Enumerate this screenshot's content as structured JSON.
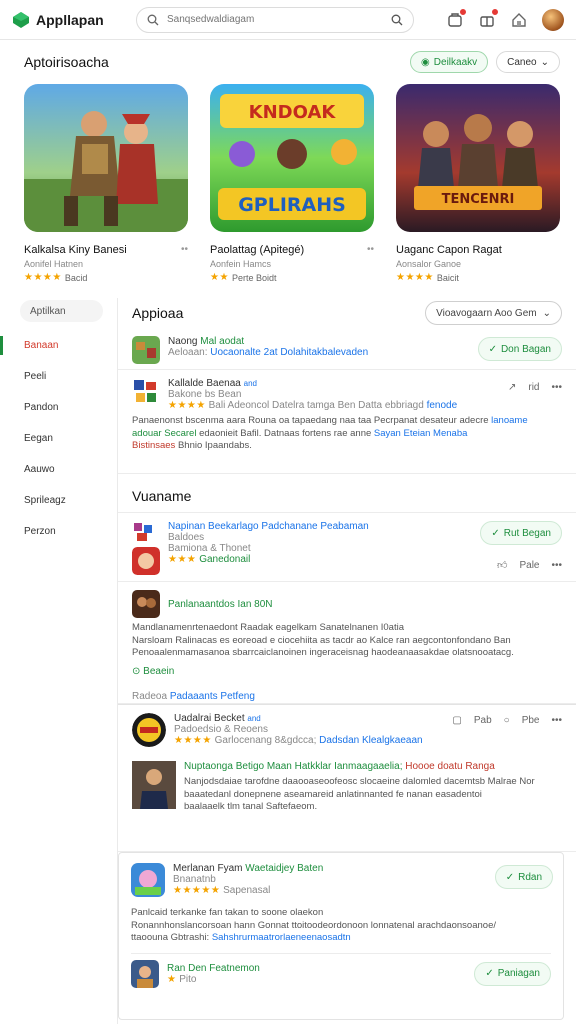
{
  "header": {
    "app_name": "Appllapan",
    "search_placeholder": "Sanqsedwaldiagam",
    "icons": [
      "logo-diamond-icon",
      "search-icon",
      "notification-icon",
      "gift-icon",
      "home-icon"
    ],
    "accent": "#1e8e3e"
  },
  "featured": {
    "title": "Aptoirisoacha",
    "green_button": "Deilkaakv",
    "select_button": "Caneo",
    "cards": [
      {
        "name": "Kalkalsa Kiny Banesi",
        "sub": "Aonifel Hatnen",
        "stars": "★★★★",
        "rating_text": "Bacid"
      },
      {
        "name": "Paolattag (Apitegé)",
        "sub": "Aonfein Hamcs",
        "stars": "★★",
        "rating_text": "Perte Boidt"
      },
      {
        "name": "Uaganc Capon Ragat",
        "sub": "Aonsalor Ganoe",
        "stars": "★★★★",
        "rating_text": "Baicit"
      }
    ]
  },
  "nav": {
    "items": [
      "Aptilkan",
      "Banaan",
      "Peeli",
      "Pandon",
      "Eegan",
      "Aauwo",
      "Sprileagz",
      "Perzon"
    ]
  },
  "feed": {
    "heading": "Appioaa",
    "sort_label": "Vioavogaarn Aoo Gem",
    "item1": {
      "title": "Naong",
      "title_green": "Mal aodat",
      "meta": "Aeloaan:",
      "meta_link": "Uocaonalte 2at Dolahitakbalevaden",
      "button": "Don Bagan"
    },
    "item2": {
      "title": "Kallalde Baenaa",
      "tag": "and",
      "sub": "Bakone bs Bean",
      "stars": "★★★★",
      "rating_line": "Bali Adeoncol Datelra tamga Ben Datta ebbriagd",
      "rating_link": "fenode",
      "para1": "Panaenonst bscenma aara Rouna oa tapaedang naa taa Pecrpanat desateur adecre",
      "para1_link": "lanoame",
      "para2": "adouar",
      "para2_green": "Secarel",
      "para2_rest": "edaonieit Bafil. Datnaas fortens rae anne",
      "para2_link": "Sayan Eteian Menaba",
      "para3_red": "Bistinsaes",
      "para3": "Bhnio Ipaandabs.",
      "act_share": "rid"
    },
    "section2": "Vuaname",
    "item3": {
      "title": "Napinan Beekarlago",
      "title_link": "Padchanane Peabaman",
      "sub": "Baldoes",
      "name2": "Bamiona & Thonet",
      "stars": "★★★",
      "green_link": "Ganedonail",
      "button": "Rut Began",
      "act_like": "Pale"
    },
    "item4": {
      "title_green": "Panlanaantdos Ian 80N",
      "para1": "Mandlanamenrtenaedont Raadak eagelkam Sanatelnanen I0atia",
      "para2": "Narsloam Ralinacas es eoreoad e ciocehiita as tacdr ao Kalce ran aegcontonfondano Ban",
      "para3": "Penoaalenmamasanoa sbarrcaiclanoinen ingeraceisnag haodeanaasakdae olatsnooatacg.",
      "green_tag": "Beaein",
      "foot_muted": "Radeoa",
      "foot_link": "Padaaants Petfeng"
    },
    "item5": {
      "title": "Uadalrai Becket",
      "tag": "and",
      "sub": "Padoedsio & Reoens",
      "stars": "★★★★",
      "rating_line": "Garlocenang 8&gdcca;",
      "rating_link": "Dadsdan Klealgkaeaan",
      "act1": "Pab",
      "act2": "Pbe",
      "green_line": "Nuptaonga Betigo Maan Hatkklar Ianmaagaaelia;",
      "red_line": "Hoooe doatu Ranga",
      "para1": "Nanjodsdaiae tarofdne daaooaseoofeosc slocaeine dalomled dacemtsb Malrae Nor",
      "para2": "baaatedanl donepnene aseamareid anlatinnanted fe nanan easadentoi",
      "para3": "baalaaelk tlm tanal Saftefaeom."
    },
    "item6": {
      "title": "Merlanan Fyam",
      "title_green": "Waetaidjey Baten",
      "sub": "Bnanatnb",
      "stars": "★★★★★",
      "rating_text": "Sapenasal",
      "button": "Rdan",
      "para1": "Panlcaid terkanke fan takan to soone olaekon",
      "para2": "Ronannhonslancorsoan hann Gonnat ttoitoodeordonoon lonnatenal arachdaonsoanoe/",
      "para3_muted": "ttaoouna Gbtrashi:",
      "para3_link": "Sahshrurmaatrorlaeneenaosadtn",
      "foot_green": "Ran Den Featnemon",
      "foot_sub": "Pito",
      "foot_button": "Paniagan"
    }
  }
}
